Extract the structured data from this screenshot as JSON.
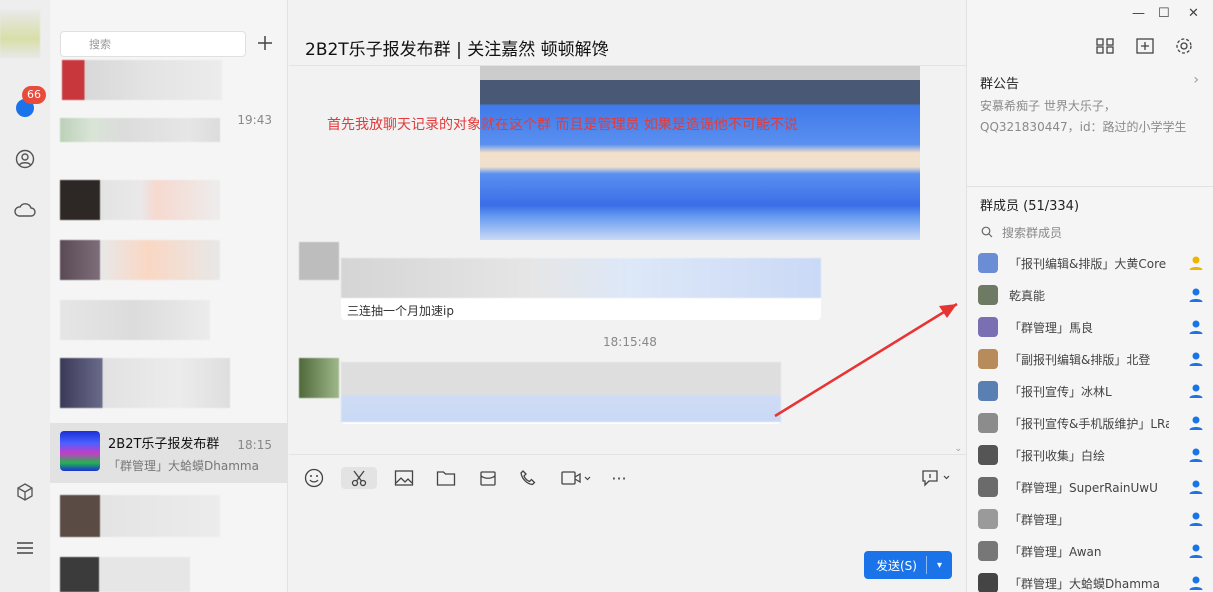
{
  "rail": {
    "badge_count": "66"
  },
  "chat_list": {
    "search_placeholder": "搜索",
    "items": [
      {
        "time": "19:43"
      },
      {
        "title": "2B2T乐子报发布群",
        "time": "18:15",
        "subtitle": "「群管理」大蛤蟆Dhamma"
      }
    ]
  },
  "chat": {
    "title": "2B2T乐子报发布群 | 关注嘉然 顿顿解馋",
    "annotation": "首先我放聊天记录的对象就在这个群 而且是管理员 如果是造谣他不可能不说",
    "timestamp": "18:15:48",
    "partial_message": "三连抽一个月加速ip",
    "send_label": "发送(S)"
  },
  "side": {
    "notice_title": "群公告",
    "notice_text": "安慕希痴子 世界大乐子，QQ321830447，id：路过的小学学生",
    "members_title": "群成员 (51/334)",
    "member_search_placeholder": "搜索群成员",
    "members": [
      {
        "name": "「报刊编辑&排版」大黄Core",
        "role": "owner"
      },
      {
        "name": "乾真能",
        "role": "member"
      },
      {
        "name": "「群管理」馬良",
        "role": "member"
      },
      {
        "name": "「副报刊编辑&排版」北登",
        "role": "member"
      },
      {
        "name": "「报刊宣传」冰林L",
        "role": "member"
      },
      {
        "name": "「报刊宣传&手机版维护」LRan",
        "role": "member"
      },
      {
        "name": "「报刊收集」白绘",
        "role": "member"
      },
      {
        "name": "「群管理」SuperRainUwU",
        "role": "member"
      },
      {
        "name": "「群管理」",
        "role": "member"
      },
      {
        "name": "「群管理」Awan",
        "role": "member"
      },
      {
        "name": "「群管理」大蛤蟆Dhamma",
        "role": "member"
      }
    ]
  },
  "colors": {
    "accent": "#1a73e8",
    "badge": "#e84b3c",
    "annotation": "#e23b3b",
    "owner_icon": "#f0b400",
    "member_icon": "#1a73e8"
  }
}
